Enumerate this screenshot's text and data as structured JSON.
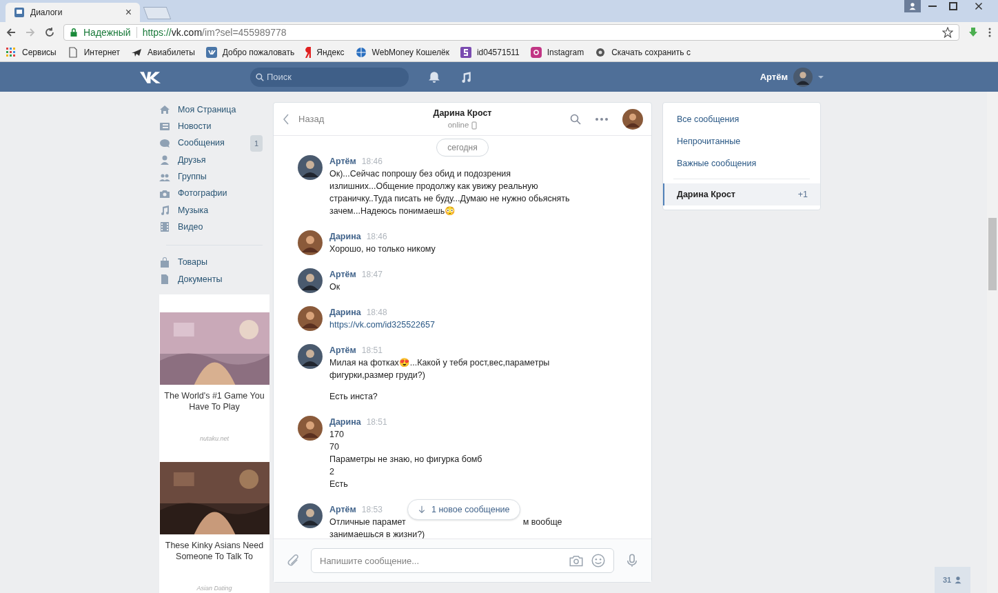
{
  "browser": {
    "tab": {
      "title": "Диалоги",
      "close": "×"
    },
    "secure_label": "Надежный",
    "url_scheme": "https://",
    "url_host": "vk.com",
    "url_path": "/im?sel=455989778",
    "bookmarks": [
      {
        "label": "Сервисы",
        "kind": "apps"
      },
      {
        "label": "Интернет",
        "kind": "page"
      },
      {
        "label": "Авиабилеты",
        "kind": "plane"
      },
      {
        "label": "Добро пожаловать",
        "kind": "vk"
      },
      {
        "label": "Яндекс",
        "kind": "yandex"
      },
      {
        "label": "WebMoney Кошелёк",
        "kind": "globe"
      },
      {
        "label": "id04571511",
        "kind": "s"
      },
      {
        "label": "Instagram",
        "kind": "insta"
      },
      {
        "label": "Скачать сохранить с",
        "kind": "eye"
      }
    ]
  },
  "header": {
    "search_placeholder": "Поиск",
    "user_name": "Артём"
  },
  "nav": [
    {
      "label": "Моя Страница"
    },
    {
      "label": "Новости"
    },
    {
      "label": "Сообщения",
      "count": "1"
    },
    {
      "label": "Друзья"
    },
    {
      "label": "Группы"
    },
    {
      "label": "Фотографии"
    },
    {
      "label": "Музыка"
    },
    {
      "label": "Видео"
    },
    {
      "label": "Товары",
      "group_start": true
    },
    {
      "label": "Документы"
    }
  ],
  "ads": [
    {
      "title": "The World's #1 Game You Have To Play",
      "source": "nutaku.net"
    },
    {
      "title": "These Kinky Asians Need Someone To Talk To",
      "source": "Asian Dating"
    }
  ],
  "chat": {
    "back": "Назад",
    "name": "Дарина Крост",
    "status": "online",
    "date_pill": "сегодня",
    "messages": [
      {
        "author": "Артём",
        "kind": "me",
        "time": "18:46",
        "paragraphs": [
          [
            "Ок)...Сейчас попрошу без обид и подозрения",
            "излишних...Общение продолжу как увижу реальную",
            "страничку..Туда писать не буду...Думаю не нужно обьяснять",
            "зачем...Надеюсь понимаешь😳"
          ]
        ]
      },
      {
        "author": "Дарина",
        "kind": "her",
        "time": "18:46",
        "paragraphs": [
          [
            "Хорошо, но только никому"
          ]
        ]
      },
      {
        "author": "Артём",
        "kind": "me",
        "time": "18:47",
        "paragraphs": [
          [
            "Ок"
          ]
        ]
      },
      {
        "author": "Дарина",
        "kind": "her",
        "time": "18:48",
        "link": "https://vk.com/id325522657"
      },
      {
        "author": "Артём",
        "kind": "me",
        "time": "18:51",
        "paragraphs": [
          [
            "Милая на фотках😍...Какой у тебя рост,вес,параметры",
            "фигурки,размер груди?)"
          ],
          [
            "Есть инста?"
          ]
        ]
      },
      {
        "author": "Дарина",
        "kind": "her",
        "time": "18:51",
        "paragraphs": [
          [
            "170",
            "70",
            "Параметры не знаю, но фигурка бомб",
            "2",
            "Есть"
          ]
        ]
      },
      {
        "author": "Артём",
        "kind": "me",
        "time": "18:53",
        "covered_line": {
          "before": "Отличные парамет",
          "after": "м вообще"
        },
        "paragraphs": [
          [
            "занимаешься в жизни?)"
          ]
        ]
      }
    ],
    "new_message_popup": "1 новое сообщение",
    "composer_placeholder": "Напишите сообщение..."
  },
  "filters": [
    {
      "label": "Все сообщения"
    },
    {
      "label": "Непрочитанные"
    },
    {
      "label": "Важные сообщения"
    }
  ],
  "dialog": {
    "name": "Дарина Крост",
    "badge": "+1",
    "selected": true
  },
  "online_count": "31"
}
